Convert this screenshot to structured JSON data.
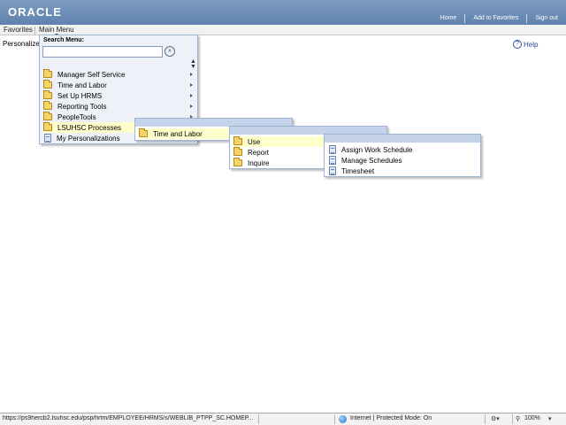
{
  "header": {
    "logo": "ORACLE",
    "links": [
      "Home",
      "Add to Favorites",
      "Sign out"
    ]
  },
  "menubar": {
    "favorites": "Favorites",
    "main_menu": "Main Menu"
  },
  "page": {
    "personalize": "Personalize",
    "help": "Help"
  },
  "main_menu": {
    "search_label": "Search Menu:",
    "search_value": "",
    "items": [
      {
        "label": "Manager Self Service",
        "icon": "folder-icon",
        "has_submenu": true
      },
      {
        "label": "Time and Labor",
        "icon": "folder-icon",
        "has_submenu": true
      },
      {
        "label": "Set Up HRMS",
        "icon": "folder-icon",
        "has_submenu": true
      },
      {
        "label": "Reporting Tools",
        "icon": "folder-icon",
        "has_submenu": true
      },
      {
        "label": "PeopleTools",
        "icon": "folder-icon",
        "has_submenu": true
      },
      {
        "label": "LSUHSC Processes",
        "icon": "folder-icon",
        "has_submenu": true,
        "active": true
      },
      {
        "label": "My Personalizations",
        "icon": "document-icon",
        "has_submenu": false
      }
    ]
  },
  "submenu_lsuhsc": {
    "items": [
      {
        "label": "Time and Labor",
        "icon": "folder-icon",
        "active": true
      }
    ]
  },
  "submenu_time_labor": {
    "items": [
      {
        "label": "Use",
        "icon": "folder-icon",
        "active": true
      },
      {
        "label": "Report",
        "icon": "folder-icon"
      },
      {
        "label": "Inquire",
        "icon": "folder-icon"
      }
    ]
  },
  "submenu_use": {
    "items": [
      {
        "label": "Assign Work Schedule",
        "icon": "document-icon"
      },
      {
        "label": "Manage Schedules",
        "icon": "document-icon"
      },
      {
        "label": "Timesheet",
        "icon": "document-icon"
      }
    ]
  },
  "statusbar": {
    "url": "https://ps9hercb2.lsuhsc.edu/psp/hrtm/EMPLOYEE/HRMS/s/WEBLIB_PTPP_SC.HOMEP...",
    "zone": "Internet | Protected Mode: On",
    "zoom": "100%"
  },
  "colors": {
    "header": "#6b8cb6",
    "panel_header": "#c4d3ea",
    "active_item": "#ffffcc",
    "folder": "#f4d36b"
  }
}
